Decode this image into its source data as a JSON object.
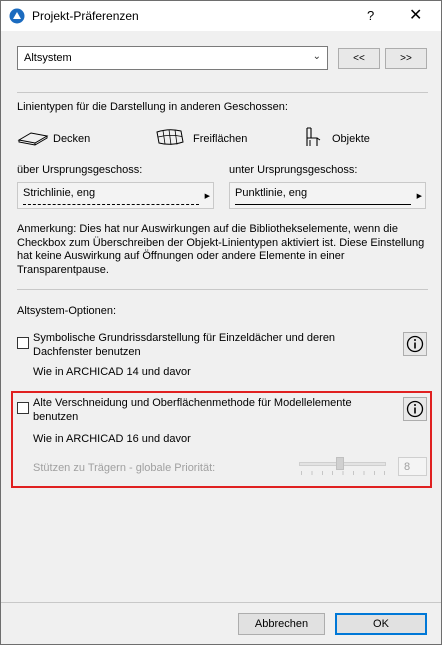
{
  "window": {
    "title": "Projekt-Präferenzen",
    "help_label": "?",
    "close_label": "✕"
  },
  "preset": {
    "selected": "Altsystem",
    "prev_label": "<<",
    "next_label": ">>"
  },
  "linetypes": {
    "heading": "Linientypen für die Darstellung in anderen Geschossen:",
    "items": [
      {
        "label": "Decken",
        "icon": "slab-icon"
      },
      {
        "label": "Freiflächen",
        "icon": "mesh-icon"
      },
      {
        "label": "Objekte",
        "icon": "chair-icon"
      }
    ],
    "above_label": "über Ursprungsgeschoss:",
    "below_label": "unter Ursprungsgeschoss:",
    "above_value": "Strichlinie, eng",
    "below_value": "Punktlinie, eng"
  },
  "note": "Anmerkung: Dies hat nur Auswirkungen auf die Bibliothekselemente, wenn die Checkbox zum Überschreiben der Objekt-Linientypen aktiviert ist. Diese Einstellung hat keine Auswirkung auf Öffnungen oder andere Elemente in einer Transparentpause.",
  "options": {
    "heading": "Altsystem-Optionen:",
    "roof": {
      "label": "Symbolische Grundrissdarstellung für Einzeldächer und deren Dachfenster benutzen",
      "sub": "Wie in ARCHICAD 14 und davor",
      "checked": false
    },
    "intersection": {
      "label": "Alte Verschneidung und Oberflächenmethode für Modellelemente benutzen",
      "sub": "Wie in ARCHICAD 16 und davor",
      "checked": false,
      "priority_label": "Stützen zu Trägern - globale Priorität:",
      "priority_value": "8",
      "priority_fraction": 0.47
    }
  },
  "footer": {
    "cancel_label": "Abbrechen",
    "ok_label": "OK"
  }
}
